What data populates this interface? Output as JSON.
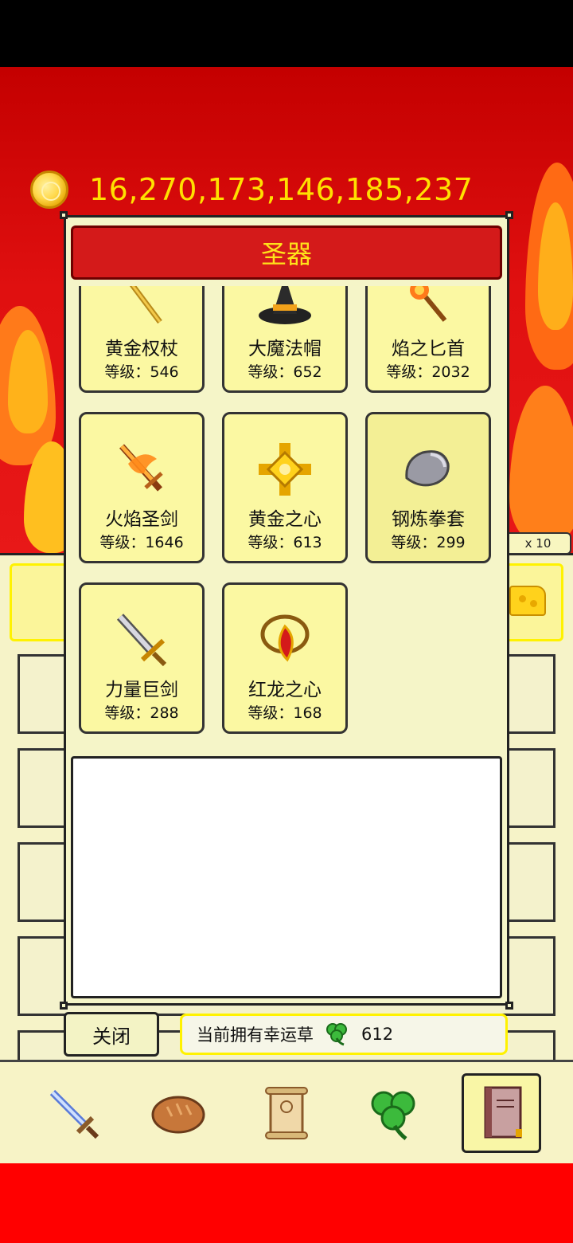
{
  "gold": {
    "amount": "16,270,173,146,185,237"
  },
  "shop": {
    "multiplier": "x 10"
  },
  "modal": {
    "title": "圣器",
    "items": [
      {
        "name": "黄金权杖",
        "level": "等级：546",
        "icon": "golden-scepter-icon"
      },
      {
        "name": "大魔法帽",
        "level": "等级：652",
        "icon": "wizard-hat-icon"
      },
      {
        "name": "焰之匕首",
        "level": "等级：2032",
        "icon": "flame-dagger-icon"
      },
      {
        "name": "火焰圣剑",
        "level": "等级：1646",
        "icon": "flame-holy-sword-icon"
      },
      {
        "name": "黄金之心",
        "level": "等级：613",
        "icon": "golden-heart-icon"
      },
      {
        "name": "钢炼拳套",
        "level": "等级：299",
        "icon": "steel-gauntlet-icon"
      },
      {
        "name": "力量巨剑",
        "level": "等级：288",
        "icon": "power-greatsword-icon"
      },
      {
        "name": "红龙之心",
        "level": "等级：168",
        "icon": "red-dragon-heart-icon"
      }
    ],
    "description": ""
  },
  "footer": {
    "close_label": "关闭",
    "clover_label": "当前拥有幸运草",
    "clover_count": "612"
  },
  "nav": [
    {
      "icon": "sword-icon"
    },
    {
      "icon": "bread-icon"
    },
    {
      "icon": "scroll-icon"
    },
    {
      "icon": "clover-icon"
    },
    {
      "icon": "book-icon",
      "active": true
    }
  ],
  "colors": {
    "title_bg": "#d41a1a",
    "title_text": "#ffe21a",
    "gold_text": "#ffe000",
    "panel_bg": "#f5f5c8",
    "card_bg": "#fbf8a2"
  }
}
